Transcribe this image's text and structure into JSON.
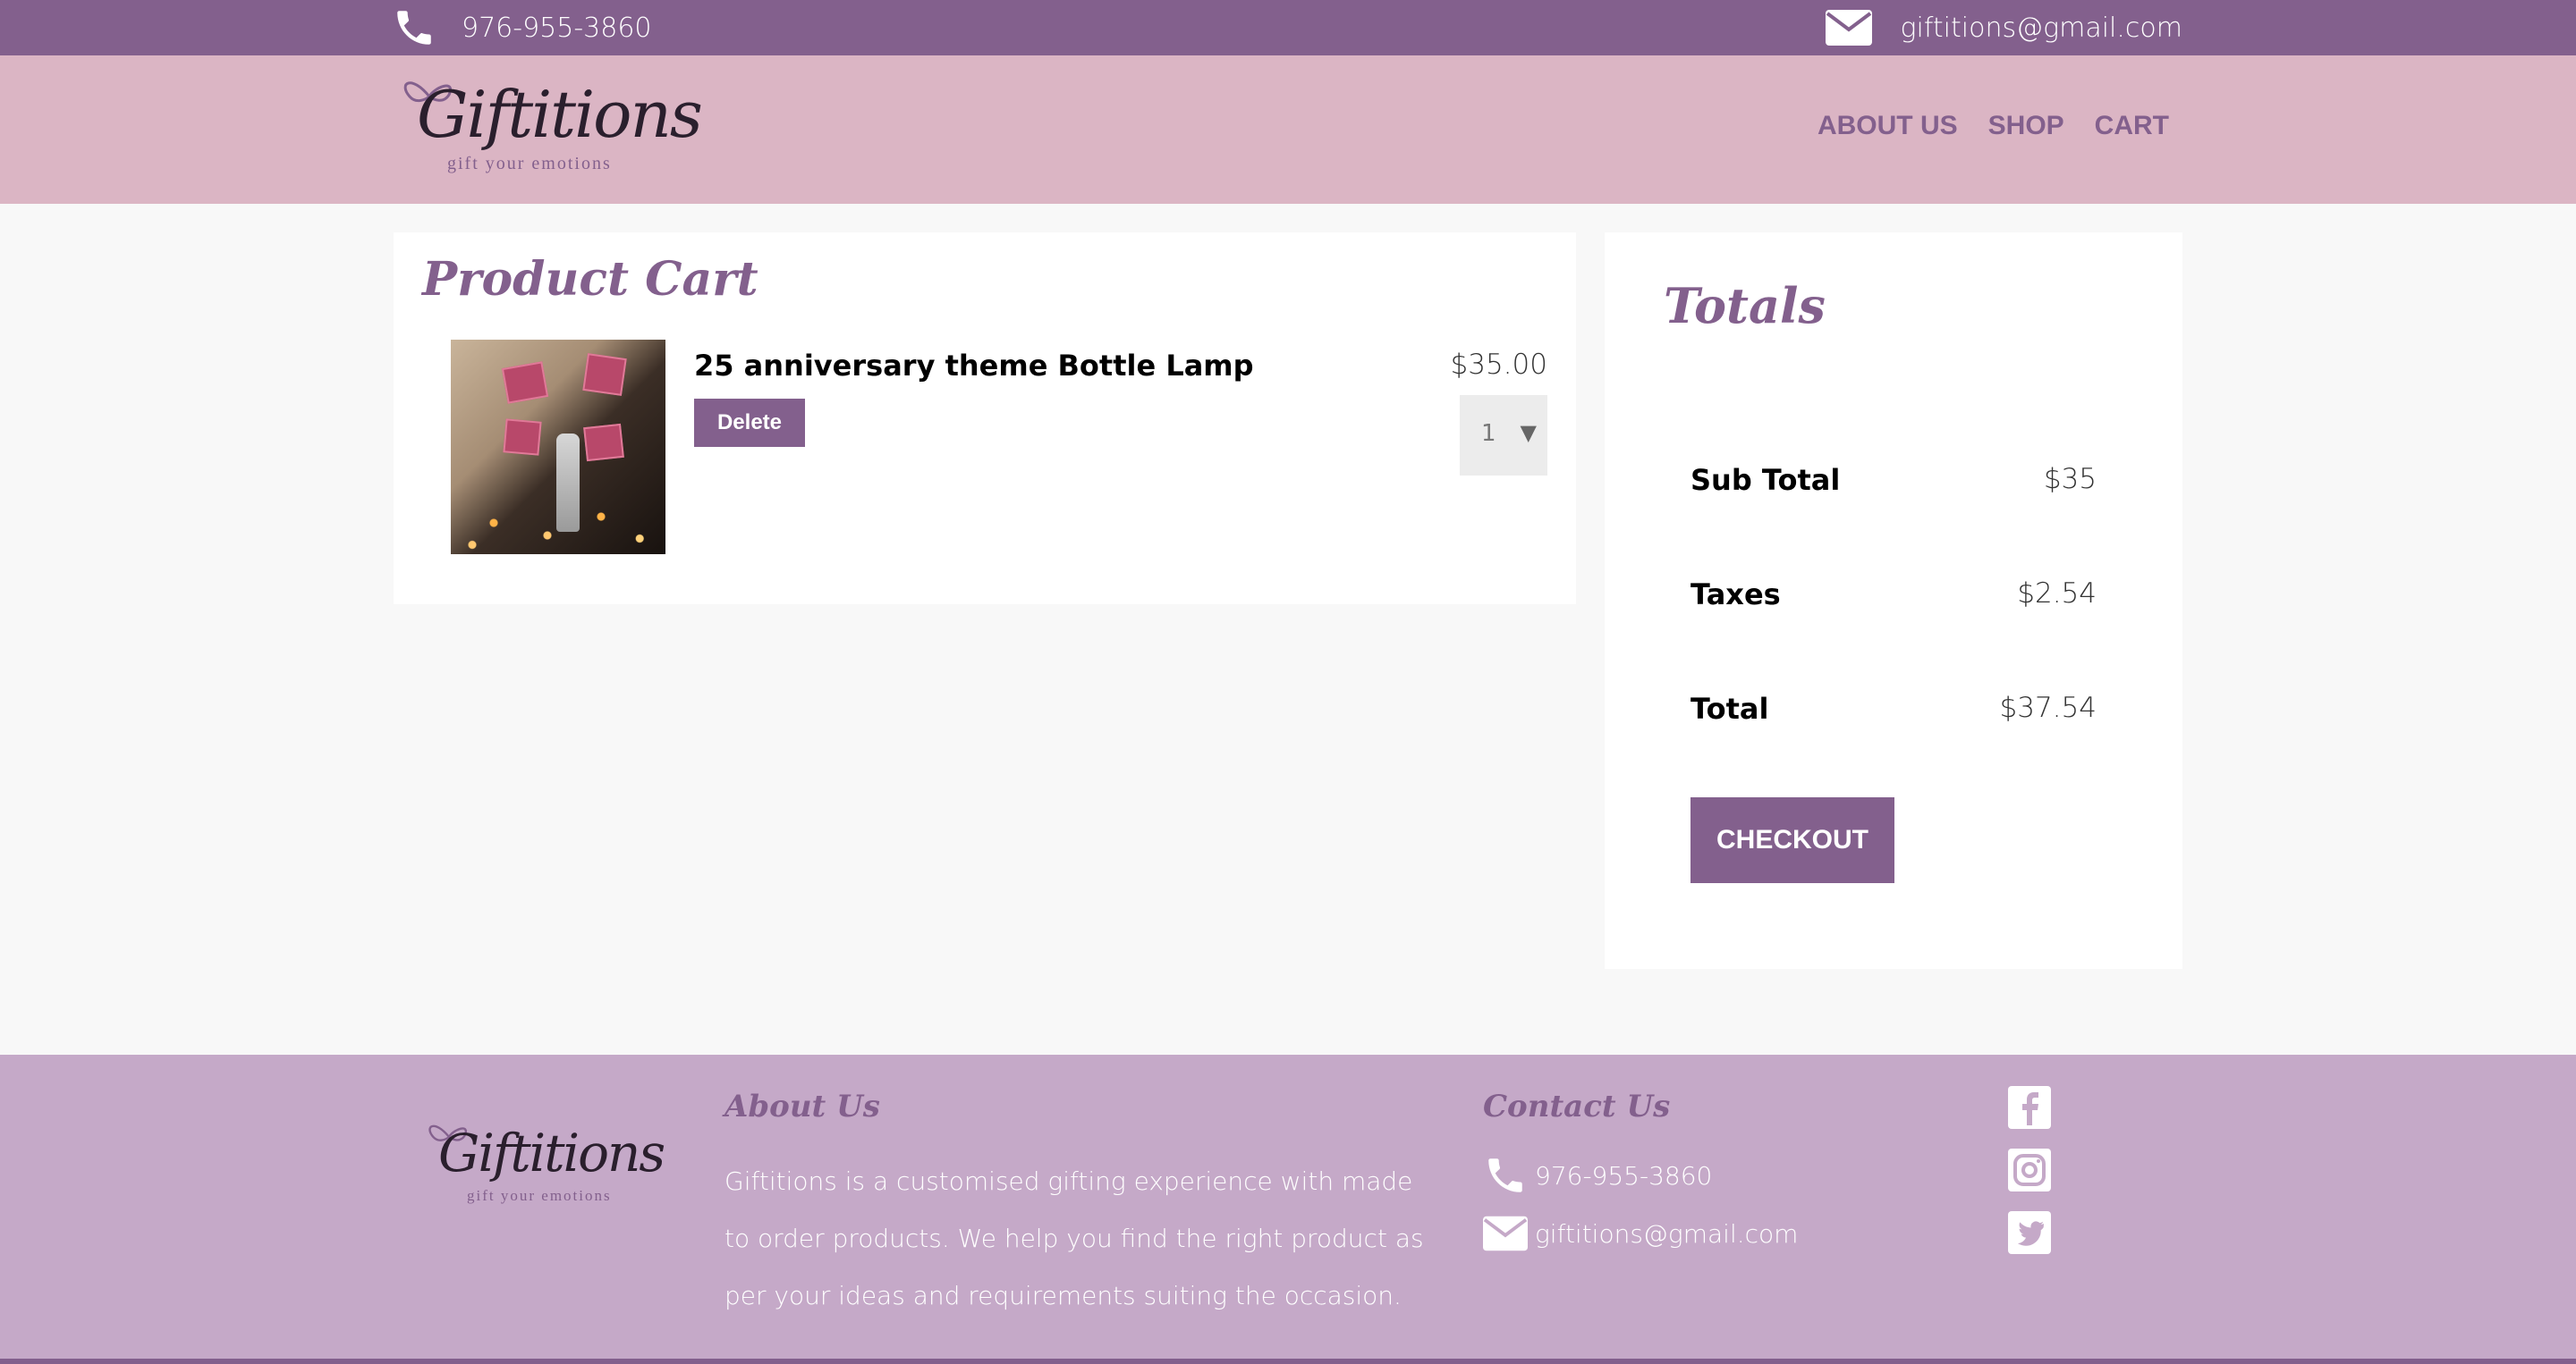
{
  "topbar": {
    "phone": "976-955-3860",
    "email": "giftitions@gmail.com"
  },
  "brand": {
    "name": "Giftitions",
    "tagline": "gift your emotions"
  },
  "nav": {
    "items": [
      "ABOUT US",
      "SHOP",
      "CART"
    ]
  },
  "cart": {
    "title": "Product Cart",
    "items": [
      {
        "name": "25 anniversary theme Bottle Lamp",
        "price": "$35.00",
        "quantity": "1",
        "delete_label": "Delete"
      }
    ]
  },
  "totals": {
    "title": "Totals",
    "rows": [
      {
        "label": "Sub Total",
        "amount": "$35"
      },
      {
        "label": "Taxes",
        "amount": "$2.54"
      },
      {
        "label": "Total",
        "amount": "$37.54"
      }
    ],
    "checkout_label": "CHECKOUT"
  },
  "footer": {
    "about_title": "About Us",
    "about_text": "Giftitions is a customised gifting experience with made to order products. We help you find the right product as per your ideas and requirements suiting the occasion.",
    "contact_title": "Contact Us",
    "phone": "976-955-3860",
    "email": "giftitions@gmail.com",
    "social": [
      "facebook-icon",
      "instagram-icon",
      "twitter-icon"
    ]
  },
  "colors": {
    "accent": "#83608d",
    "header_bg": "#dbb5c4",
    "footer_bg": "#c5a9c8",
    "page_bg": "#f8f8f8"
  }
}
